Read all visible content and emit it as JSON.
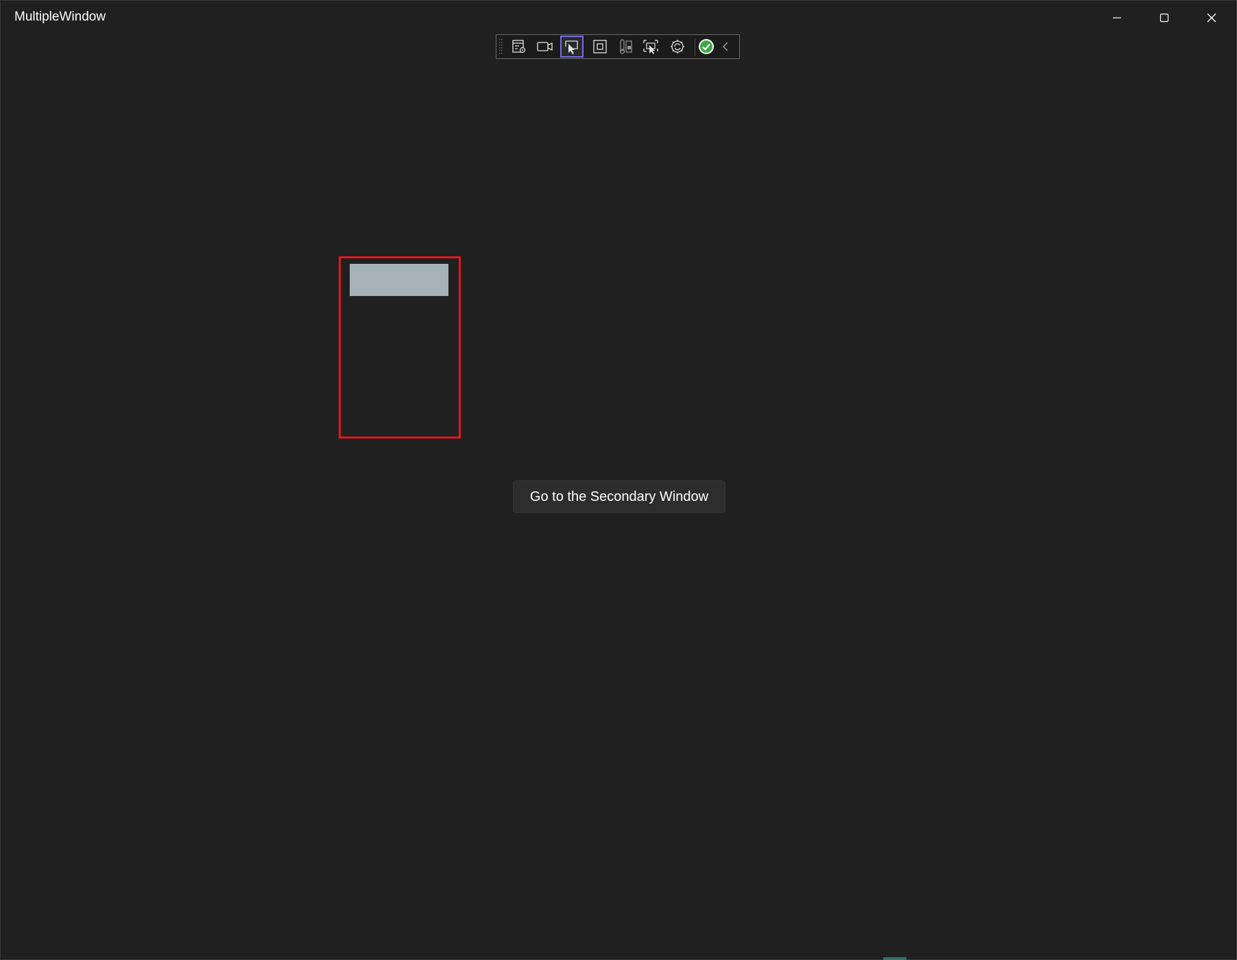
{
  "window": {
    "title": "MultipleWindow"
  },
  "caption_buttons": {
    "minimize": "minimize-icon",
    "maximize": "maximize-icon",
    "close": "close-icon"
  },
  "dev_toolbar": {
    "items": [
      {
        "name": "live-visual-tree-icon"
      },
      {
        "name": "video-record-icon"
      },
      {
        "name": "select-element-icon",
        "selected": true
      },
      {
        "name": "display-layout-adorners-icon"
      },
      {
        "name": "track-focused-element-icon"
      },
      {
        "name": "preview-selection-icon"
      },
      {
        "name": "hot-reload-icon"
      },
      {
        "name": "check-issues-icon"
      },
      {
        "name": "collapse-toolbar-icon"
      }
    ],
    "selected_color": "#7c6ee6"
  },
  "canvas": {
    "highlight_color": "#e5161d",
    "placeholder_color": "#a7b1b9"
  },
  "main": {
    "button_label": "Go to the Secondary Window"
  }
}
